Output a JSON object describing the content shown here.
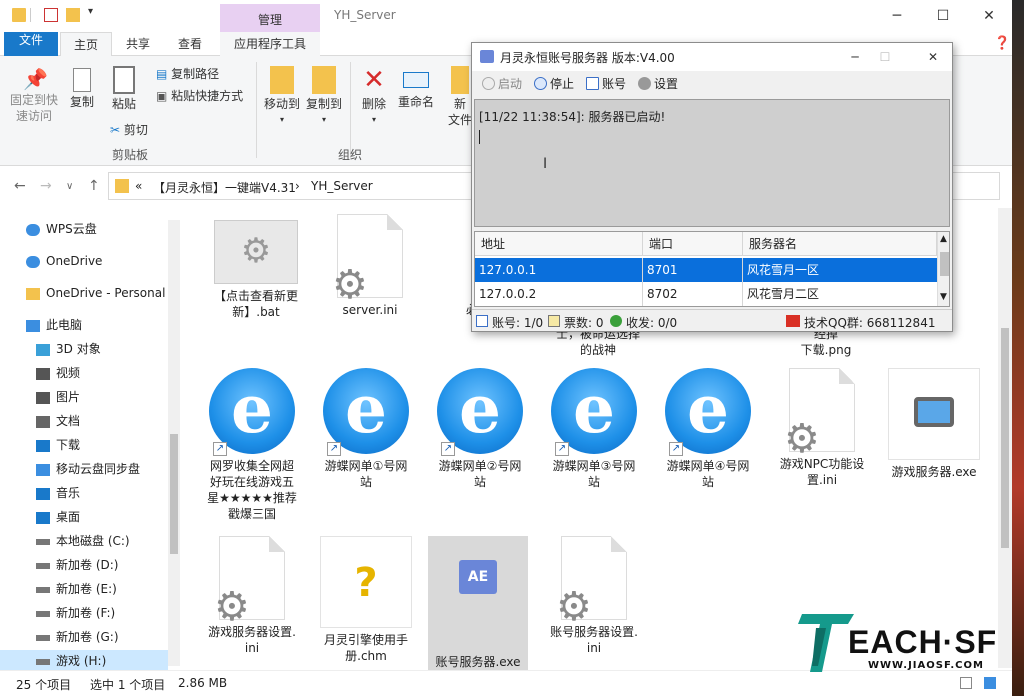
{
  "explorer": {
    "context_group_label": "管理",
    "window_title": "YH_Server",
    "tabs": [
      "文件",
      "主页",
      "共享",
      "查看",
      "应用程序工具"
    ],
    "ribbon": {
      "pin_label": "固定到快\n速访问",
      "copy_label": "复制",
      "paste_label": "粘贴",
      "copy_path_label": "复制路径",
      "paste_shortcut_label": "粘贴快捷方式",
      "cut_label": "剪切",
      "clipboard_group": "剪贴板",
      "move_to_label": "移动到",
      "copy_to_label": "复制到",
      "delete_label": "删除",
      "rename_label": "重命名",
      "new_label": "新",
      "file_label": "文件",
      "organize_group": "组织"
    },
    "breadcrumb": [
      "«",
      "【月灵永恒】一键端V4.31",
      "›",
      "YH_Server"
    ],
    "nav_tree": [
      {
        "label": "WPS云盘",
        "icon": "cloud-icon"
      },
      {
        "label": "OneDrive",
        "icon": "cloud-icon"
      },
      {
        "label": "OneDrive - Personal",
        "icon": "folder-icon"
      },
      {
        "label": "此电脑",
        "icon": "computer-icon"
      },
      {
        "label": "3D 对象",
        "icon": "cube-icon"
      },
      {
        "label": "视频",
        "icon": "video-icon"
      },
      {
        "label": "图片",
        "icon": "picture-icon"
      },
      {
        "label": "文档",
        "icon": "document-icon"
      },
      {
        "label": "下载",
        "icon": "download-icon"
      },
      {
        "label": "移动云盘同步盘",
        "icon": "cloud-sync-icon"
      },
      {
        "label": "音乐",
        "icon": "music-icon"
      },
      {
        "label": "桌面",
        "icon": "desktop-icon"
      },
      {
        "label": "本地磁盘 (C:)",
        "icon": "drive-icon"
      },
      {
        "label": "新加卷 (D:)",
        "icon": "drive-icon"
      },
      {
        "label": "新加卷 (E:)",
        "icon": "drive-icon"
      },
      {
        "label": "新加卷 (F:)",
        "icon": "drive-icon"
      },
      {
        "label": "新加卷 (G:)",
        "icon": "drive-icon"
      },
      {
        "label": "游戏 (H:)",
        "icon": "drive-icon"
      }
    ],
    "files": [
      {
        "name": "【点击查看新更\n新】.bat",
        "type": "bat"
      },
      {
        "name": "server.ini",
        "type": "ini"
      },
      {
        "name": "必看说\n者",
        "type": "partial"
      },
      {
        "name": "士，被命运选择\n的战神",
        "type": "partial-text"
      },
      {
        "name": "经掉\n下载.png",
        "type": "partial-right"
      },
      {
        "name": "网罗收集全网超\n好玩在线游戏五\n星★★★★★推荐\n戳爆三国",
        "type": "url"
      },
      {
        "name": "游蝶网单①号网\n站",
        "type": "url"
      },
      {
        "name": "游蝶网单②号网\n站",
        "type": "url"
      },
      {
        "name": "游蝶网单③号网\n站",
        "type": "url"
      },
      {
        "name": "游蝶网单④号网\n站",
        "type": "url"
      },
      {
        "name": "游戏NPC功能设\n置.ini",
        "type": "ini"
      },
      {
        "name": "游戏服务器.exe",
        "type": "exe"
      },
      {
        "name": "游戏服务器设置.\nini",
        "type": "ini"
      },
      {
        "name": "月灵引擎使用手\n册.chm",
        "type": "chm"
      },
      {
        "name": "账号服务器.exe",
        "type": "exe-sel"
      },
      {
        "name": "账号服务器设置.\nini",
        "type": "ini"
      }
    ],
    "status": {
      "count": "25 个项目",
      "selected": "选中 1 个项目",
      "size": "2.86 MB"
    }
  },
  "dialog": {
    "title": "月灵永恒账号服务器 版本:V4.00",
    "toolbar": {
      "start": "启动",
      "stop": "停止",
      "account": "账号",
      "settings": "设置"
    },
    "log_line": "[11/22 11:38:54]: 服务器已启动!",
    "table": {
      "headers": [
        "地址",
        "端口",
        "服务器名"
      ],
      "rows": [
        [
          "127.0.0.1",
          "8701",
          "风花雪月一区"
        ],
        [
          "127.0.0.2",
          "8702",
          "风花雪月二区"
        ]
      ]
    },
    "status": {
      "account": "账号: 1/0",
      "tickets": "票数: 0",
      "traffic": "收发: 0/0",
      "qq": "技术QQ群: 668112841"
    }
  },
  "watermark": {
    "brand": "EACH·SF",
    "url": "WWW.JIAOSF.COM"
  }
}
